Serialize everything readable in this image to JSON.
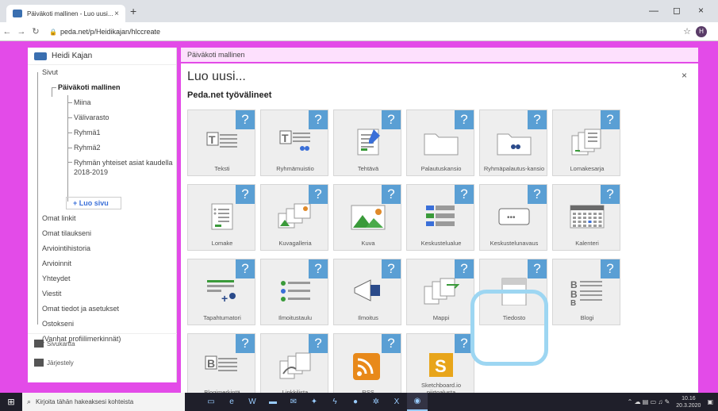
{
  "browser": {
    "tab_title": "Päiväkoti mallinen - Luo uusi...",
    "tab_close": "×",
    "new_tab": "+",
    "url": "peda.net/p/Heidikajan/hlccreate",
    "minimize": "—",
    "maximize": "◻",
    "close": "×",
    "profile_initial": "H"
  },
  "sidebar": {
    "user_name": "Heidi Kajan",
    "items": [
      {
        "label": "Sivut",
        "level": 0
      },
      {
        "label": "Päiväkoti mallinen",
        "level": 1
      },
      {
        "label": "Miina",
        "level": 2
      },
      {
        "label": "Välivarasto",
        "level": 2
      },
      {
        "label": "Ryhmä1",
        "level": 2
      },
      {
        "label": "Ryhmä2",
        "level": 2
      },
      {
        "label": "Ryhmän yhteiset asiat kaudella 2018-2019",
        "level": 2
      }
    ],
    "create_page": "+ Luo sivu",
    "bottom_items": [
      "Omat linkit",
      "Omat tilaukseni",
      "Arviointihistoria",
      "Arvioinnit",
      "Yhteydet",
      "Viestit",
      "Omat tiedot ja asetukset",
      "Ostokseni",
      "(Vanhat profiilimerkinnät)"
    ],
    "footer": [
      "Sivukartta",
      "Järjestely"
    ]
  },
  "breadcrumb": "Päiväkoti mallinen",
  "main": {
    "title": "Luo uusi...",
    "close": "×",
    "subtitle": "Peda.net työvälineet",
    "help_mark": "?",
    "tools": [
      {
        "label": "Teksti",
        "icon": "text-icon"
      },
      {
        "label": "Ryhmämuistio",
        "icon": "group-memo-icon"
      },
      {
        "label": "Tehtävä",
        "icon": "task-icon"
      },
      {
        "label": "Palautuskansio",
        "icon": "folder-icon"
      },
      {
        "label": "Ryhmäpalautus-kansio",
        "icon": "group-folder-icon"
      },
      {
        "label": "Lomakesarja",
        "icon": "form-series-icon"
      },
      {
        "label": "Lomake",
        "icon": "form-icon"
      },
      {
        "label": "Kuvagalleria",
        "icon": "gallery-icon"
      },
      {
        "label": "Kuva",
        "icon": "image-icon"
      },
      {
        "label": "Keskustelualue",
        "icon": "discussion-area-icon"
      },
      {
        "label": "Keskustelunavaus",
        "icon": "discussion-opening-icon"
      },
      {
        "label": "Kalenteri",
        "icon": "calendar-icon"
      },
      {
        "label": "Tapahtumatori",
        "icon": "event-market-icon"
      },
      {
        "label": "Ilmoitustaulu",
        "icon": "bulletin-board-icon"
      },
      {
        "label": "Ilmoitus",
        "icon": "announcement-icon"
      },
      {
        "label": "Mappi",
        "icon": "binder-icon"
      },
      {
        "label": "Tiedosto",
        "icon": "file-icon"
      },
      {
        "label": "Blogi",
        "icon": "blog-icon"
      },
      {
        "label": "Blogimerkintä",
        "icon": "blog-entry-icon"
      },
      {
        "label": "Linkkilista",
        "icon": "link-list-icon"
      },
      {
        "label": "RSS",
        "icon": "rss-icon"
      },
      {
        "label": "Sketchboard.io piirtoalusta",
        "icon": "sketchboard-icon"
      }
    ]
  },
  "taskbar": {
    "search_placeholder": "Kirjoita tähän hakeaksesi kohteista",
    "time": "10.16",
    "date": "20.3.2020"
  },
  "colors": {
    "page_bg": "#e34be8",
    "help_badge": "#5a9fd4",
    "highlight": "#9dd6f2",
    "link": "#3a6fd8"
  }
}
